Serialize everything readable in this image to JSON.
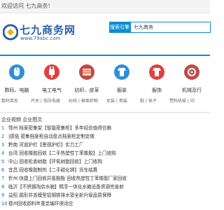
{
  "topbar": {
    "welcome": "欢迎访问 七九商务!"
  },
  "logo": {
    "brand": "七九商务网",
    "url": "www.79abc.com"
  },
  "search": {
    "label": "搜索引擎",
    "value": "七九商务"
  },
  "categories": [
    {
      "name": "数码、电脑",
      "icon": "mouse-icon",
      "color": "#2f8fd6"
    },
    {
      "name": "电工电气",
      "icon": "plug-icon",
      "color": "#e04040"
    },
    {
      "name": "纺织、皮革",
      "icon": "cloth-icon",
      "color": "#c04a4a"
    },
    {
      "name": "服装",
      "icon": "clothes-icon",
      "color": "#2f8fd6"
    },
    {
      "name": "服饰",
      "icon": "shirt-icon",
      "color": "#e04040"
    },
    {
      "name": "机械及行",
      "icon": "machine-icon",
      "color": "#c04a4a"
    }
  ],
  "subcategories": [
    "数码单反",
    "开关 | 低压电器",
    "纱线 | 棉类织物",
    "女装 | 男装",
    "鞋 | 袜子",
    "塑料机械 | 印"
  ],
  "tabs": {
    "label": "企业视频 企业图文"
  },
  "news": [
    {
      "num": "1",
      "text": "鄂州 档案密集架【智能密集柜】多年经验值得信赖"
    },
    {
      "num": "2",
      "text": "|德佑 密集档案柜自动盘点档案柜定制定做"
    },
    {
      "num": "3",
      "text": "黔南 河道护栏【景观护栏】实力工厂"
    },
    {
      "num": "4",
      "text": "台湾 回收橡胶回收【二手热塑性丁苯橡胶】上门收购"
    },
    {
      "num": "5",
      "text": "中山 回收松香树脂【环氧树脂回收】上门收购"
    },
    {
      "num": "6",
      "text": "宜昌 回收橡胶制剂【二手碳化钾】货车结算"
    },
    {
      "num": "7",
      "text": "忻州 快捷上门回收异氰酸酯 回收热塑性丁苯橡胶厂家回收"
    },
    {
      "num": "8",
      "text": "临沂【不锈钢淘店水箱】精享一体化水箱设备资源完善射"
    },
    {
      "num": "9",
      "text": "益阳 圆形井盖模型铝钢铁排水管全新升级品质保障"
    },
    {
      "num": "10",
      "text": "德州回收颜料年重定编环保适应"
    }
  ]
}
